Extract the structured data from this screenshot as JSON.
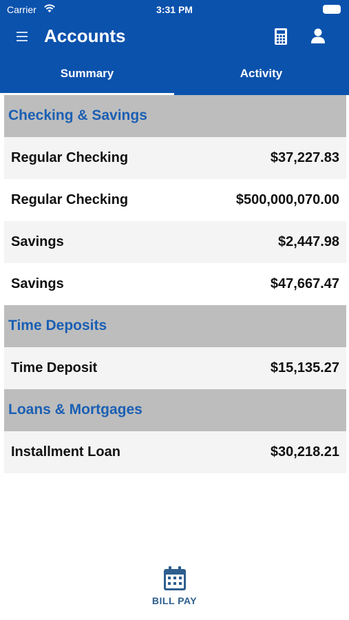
{
  "status_bar": {
    "carrier": "Carrier",
    "time": "3:31 PM",
    "icons": [
      "wifi-icon",
      "battery-icon"
    ]
  },
  "nav": {
    "title": "Accounts",
    "left_icon": "menu-icon",
    "right_icons": [
      "calculator-icon",
      "user-icon"
    ]
  },
  "tabs": [
    {
      "label": "Summary",
      "selected": true
    },
    {
      "label": "Activity",
      "selected": false
    }
  ],
  "sections": [
    {
      "title": "Checking & Savings",
      "accounts": [
        {
          "name": "Regular Checking",
          "balance": "$37,227.83"
        },
        {
          "name": "Regular Checking",
          "balance": "$500,000,070.00"
        },
        {
          "name": "Savings",
          "balance": "$2,447.98"
        },
        {
          "name": "Savings",
          "balance": "$47,667.47"
        }
      ]
    },
    {
      "title": "Time Deposits",
      "accounts": [
        {
          "name": "Time Deposit",
          "balance": "$15,135.27"
        }
      ]
    },
    {
      "title": "Loans & Mortgages",
      "accounts": [
        {
          "name": "Installment Loan",
          "balance": "$30,218.21"
        }
      ]
    }
  ],
  "bottom_action": {
    "label": "BILL PAY",
    "icon": "calendar-icon"
  },
  "colors": {
    "brand_blue": "#0b52ad",
    "section_title": "#1a5fb4",
    "section_bg": "#bdbdbd",
    "row_shade": "#f4f4f4",
    "bill_pay": "#2d5e8e"
  }
}
